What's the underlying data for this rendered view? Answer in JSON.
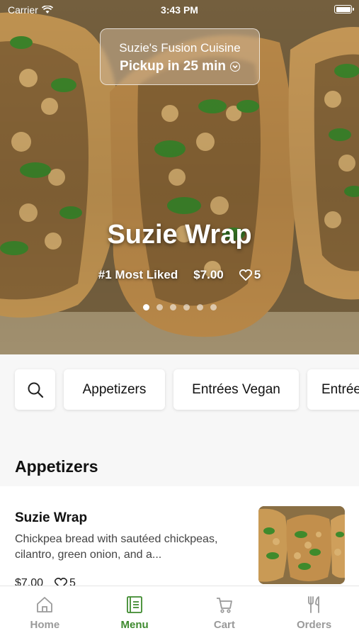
{
  "status_bar": {
    "carrier": "Carrier",
    "time": "3:43 PM"
  },
  "restaurant": {
    "name": "Suzie's Fusion Cuisine",
    "pickup": "Pickup in 25 min"
  },
  "hero": {
    "title": "Suzie Wrap",
    "rank": "#1 Most Liked",
    "price": "$7.00",
    "likes": "5",
    "dots_total": 6,
    "dots_active": 1
  },
  "categories": [
    "Appetizers",
    "Entrées Vegan",
    "Entrée"
  ],
  "section": {
    "title": "Appetizers"
  },
  "item": {
    "name": "Suzie Wrap",
    "description": "Chickpea bread with sautéed chickpeas, cilantro, green onion, and a...",
    "price": "$7.00",
    "likes": "5"
  },
  "tabs": [
    {
      "label": "Home",
      "icon": "home-icon",
      "active": false
    },
    {
      "label": "Menu",
      "icon": "menu-icon",
      "active": true
    },
    {
      "label": "Cart",
      "icon": "cart-icon",
      "active": false
    },
    {
      "label": "Orders",
      "icon": "orders-icon",
      "active": false
    }
  ],
  "colors": {
    "accent": "#3e8a2e",
    "inactive": "#9a9a9a",
    "background": "#f7f7f7"
  }
}
